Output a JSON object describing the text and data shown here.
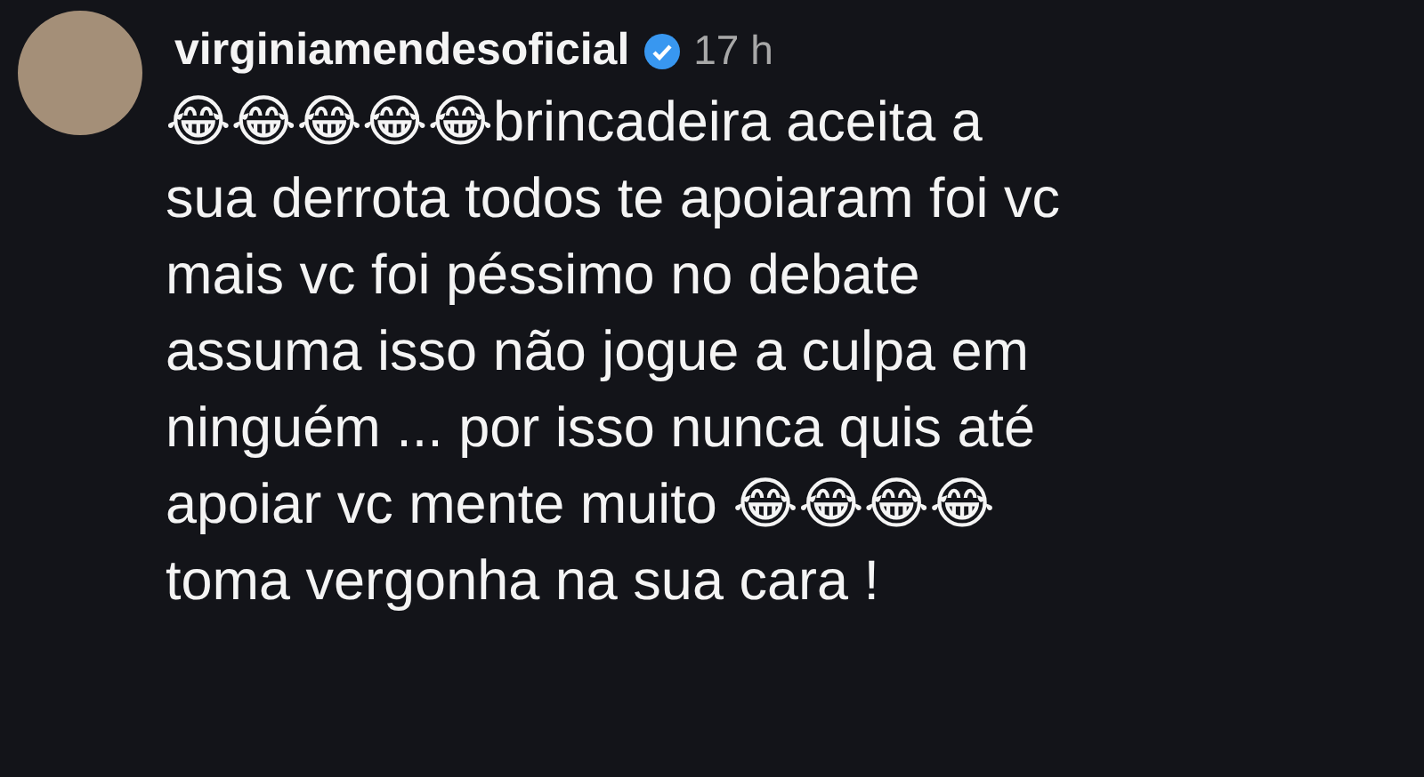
{
  "comment": {
    "username": "virginiamendesoficial",
    "verified": true,
    "time": "17 h",
    "text": "😂😂😂😂😂brincadeira aceita a\nsua derrota todos te apoiaram foi vc\nmais vc foi péssimo no debate\nassuma isso não jogue a culpa em\nninguém ... por isso nunca quis até\napoiar vc mente muito 😂😂😂😂\ntoma vergonha na sua cara !"
  }
}
